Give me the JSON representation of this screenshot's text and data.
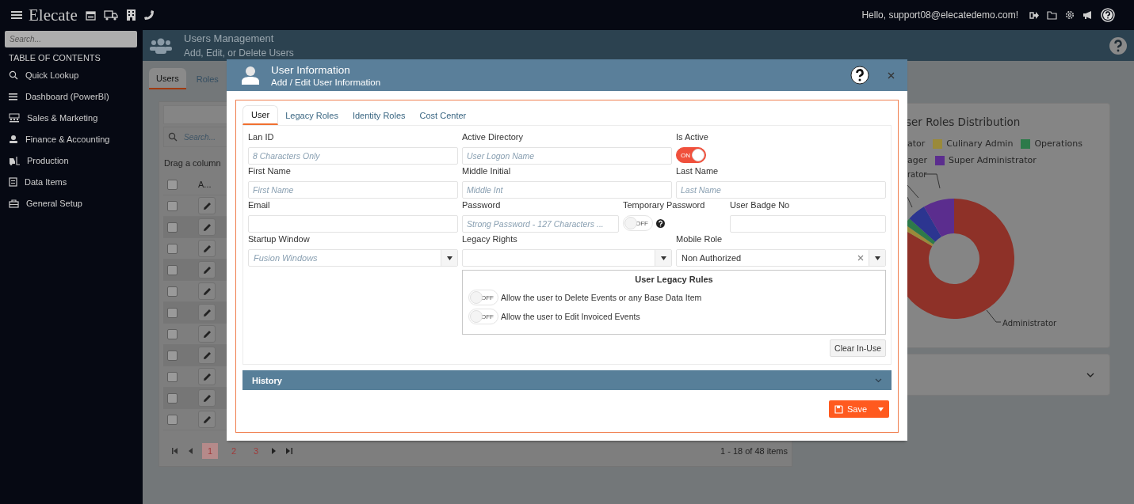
{
  "top_bar": {
    "brand": "Elecate",
    "greeting": "Hello, support08@elecatedemo.com!"
  },
  "sidebar": {
    "search": {
      "placeholder": "Search..."
    },
    "heading": "TABLE OF CONTENTS",
    "items": [
      {
        "label": "Quick Lookup"
      },
      {
        "label": "Dashboard (PowerBI)"
      },
      {
        "label": "Sales & Marketing"
      },
      {
        "label": "Finance & Accounting"
      },
      {
        "label": "Production"
      },
      {
        "label": "Data Items"
      },
      {
        "label": "General Setup"
      }
    ]
  },
  "page_header": {
    "title": "Users Management",
    "subtitle": "Add, Edit, or Delete Users"
  },
  "page_tabs": [
    {
      "label": "Users",
      "selected": true
    },
    {
      "label": "Roles",
      "selected": false
    }
  ],
  "grid": {
    "search": {
      "placeholder": "Search..."
    },
    "group_hint": "Drag a column",
    "all_checked": false,
    "columns": [
      "A..."
    ],
    "rows": [
      {
        "checked": false
      },
      {
        "checked": false
      },
      {
        "checked": false
      },
      {
        "checked": false
      },
      {
        "checked": false
      },
      {
        "checked": false
      },
      {
        "checked": false
      },
      {
        "checked": false
      },
      {
        "checked": false
      },
      {
        "checked": false
      },
      {
        "checked": false
      }
    ],
    "pages": [
      {
        "label": "1",
        "selected": true
      },
      {
        "label": "2",
        "selected": false
      },
      {
        "label": "3",
        "selected": false
      }
    ],
    "summary": "1 - 18 of 48 items"
  },
  "chart_card": {
    "title": "ser Roles Distribution",
    "legend": [
      {
        "label": "ator"
      },
      {
        "label": "Culinary Admin",
        "color": "#9a8a3a"
      },
      {
        "label": "Operations",
        "color": "#2d7a4a"
      },
      {
        "label": "ager"
      },
      {
        "label": "Super Administrator",
        "color": "#5b2d8e"
      }
    ],
    "slice_labels": [
      "rator",
      "Administrator"
    ]
  },
  "modal": {
    "title": "User Information",
    "subtitle": "Add / Edit User Information",
    "tabs": [
      {
        "label": "User",
        "selected": true
      },
      {
        "label": "Legacy Roles",
        "selected": false
      },
      {
        "label": "Identity Roles",
        "selected": false
      },
      {
        "label": "Cost Center",
        "selected": false
      }
    ],
    "rows": [
      [
        {
          "kind": "text",
          "label": "Lan ID",
          "placeholder": "8 Characters Only"
        },
        {
          "kind": "text",
          "label": "Active Directory",
          "placeholder": "User Logon Name"
        },
        {
          "kind": "toggle",
          "label": "Is Active",
          "on": true,
          "text": "ON"
        }
      ],
      [
        {
          "kind": "text",
          "label": "First Name",
          "placeholder": "First Name"
        },
        {
          "kind": "text",
          "label": "Middle Initial",
          "placeholder": "Middle Int"
        },
        {
          "kind": "text",
          "label": "Last Name",
          "placeholder": "Last Name"
        }
      ],
      [
        {
          "kind": "text",
          "label": "Email"
        },
        {
          "kind": "text",
          "label": "Password",
          "placeholder": "Strong Password - 127 Characters ..."
        },
        {
          "kind": "toggle",
          "label": "Temporary Password",
          "on": false,
          "text": "OFF",
          "help": true
        },
        {
          "kind": "text",
          "label": "User Badge No"
        }
      ],
      [
        {
          "kind": "select",
          "label": "Startup Window",
          "placeholder": "Fusion Windows"
        },
        {
          "kind": "select",
          "label": "Legacy Rights"
        },
        {
          "kind": "select",
          "label": "Mobile Role",
          "value": "Non Authorized"
        }
      ]
    ],
    "legacy_rules": {
      "title": "User Legacy Rules",
      "rules": [
        {
          "label": "Allow the user to Delete Events or any Base Data Item",
          "on": false,
          "text": "OFF"
        },
        {
          "label": "Allow the user to Edit Invoiced Events",
          "on": false,
          "text": "OFF"
        }
      ]
    },
    "clear_button": "Clear In-Use",
    "history": {
      "title": "History",
      "expanded": false
    },
    "save_button": "Save"
  }
}
